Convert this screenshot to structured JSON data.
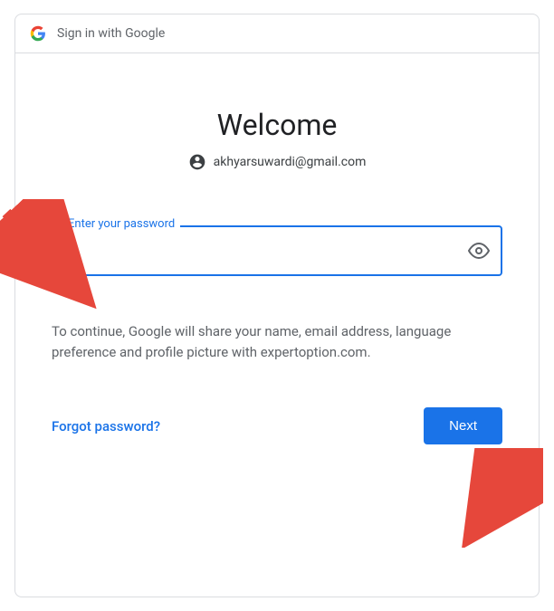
{
  "header": {
    "title": "Sign in with Google"
  },
  "main": {
    "welcome": "Welcome",
    "email": "akhyarsuwardi@gmail.com",
    "password_label": "Enter your password",
    "password_value": "",
    "disclosure": "To continue, Google will share your name, email address, language preference and profile picture with expertoption.com.",
    "forgot_label": "Forgot password?",
    "next_label": "Next"
  }
}
